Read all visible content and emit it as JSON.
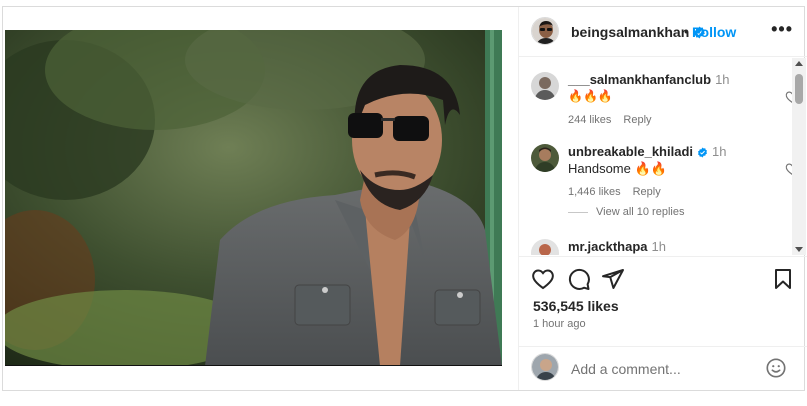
{
  "post": {
    "username": "beingsalmankhan",
    "dot": "•",
    "follow_label": "Follow",
    "more_label": "•••"
  },
  "comments": [
    {
      "username": "___salmankhanfanclub",
      "time": "1h",
      "text": "🔥🔥🔥",
      "likes": "244 likes",
      "reply": "Reply"
    },
    {
      "username": "unbreakable_khiladi",
      "time": "1h",
      "text": "Handsome 🔥🔥",
      "likes": "1,446 likes",
      "reply": "Reply"
    },
    {
      "username": "mr.jackthapa",
      "time": "1h",
      "text": "❤❤❤❤"
    }
  ],
  "view_replies": "View all 10 replies",
  "likes_count": "536,545 likes",
  "time_ago": "1 hour ago",
  "add_comment": {
    "placeholder": "Add a comment..."
  },
  "icons": {
    "verified": "verified-badge-icon",
    "like": "heart-icon",
    "comment": "comment-icon",
    "share": "share-icon",
    "save": "bookmark-icon",
    "emoji": "emoji-icon"
  },
  "colors": {
    "accent": "#0095f6",
    "verified": "#0095f6",
    "text": "#262626",
    "muted": "#737373"
  }
}
